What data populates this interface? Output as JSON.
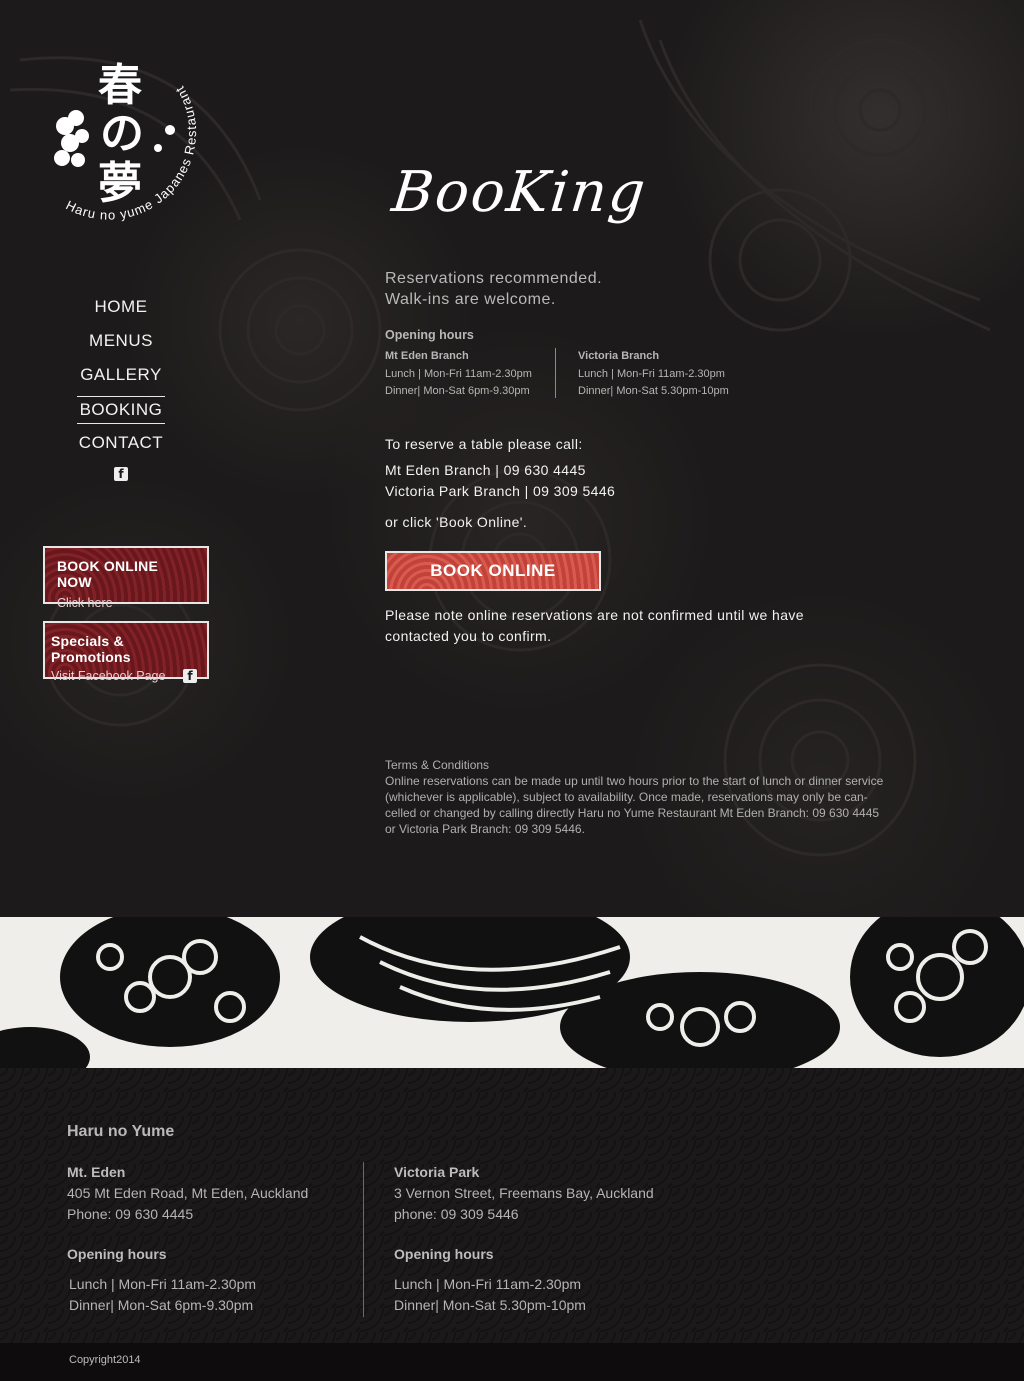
{
  "logo": {
    "kanji": [
      "春",
      "の",
      "夢"
    ],
    "ring_text": "Haru no yume Japanes Restaurant"
  },
  "nav": {
    "items": [
      "HOME",
      "MENUS",
      "GALLERY",
      "BOOKING",
      "CONTACT"
    ],
    "active": "BOOKING",
    "facebook_icon": "facebook-icon"
  },
  "promos": {
    "book_title": "BOOK ONLINE NOW",
    "book_sub": "Click here",
    "specials_title": "Specials & Promotions",
    "specials_sub": "Visit Facebook Page"
  },
  "main": {
    "title": "BooKing",
    "intro_line1": "Reservations recommended.",
    "intro_line2": "Walk-ins are welcome.",
    "hours_title": "Opening hours",
    "branches": [
      {
        "name": "Mt Eden Branch",
        "lunch": "Lunch | Mon-Fri   11am-2.30pm",
        "dinner": "Dinner| Mon-Sat  6pm-9.30pm"
      },
      {
        "name": "Victoria Branch",
        "lunch": "Lunch | Mon-Fri   11am-2.30pm",
        "dinner": "Dinner| Mon-Sat  5.30pm-10pm"
      }
    ],
    "reserve_intro": "To reserve a table please call:",
    "reserve_line1": "Mt Eden Branch | 09 630 4445",
    "reserve_line2": "Victoria Park Branch | 09 309 5446",
    "or_click": "or click 'Book Online'.",
    "book_button": "BOOK ONLINE",
    "note": "Please note online reservations are not confirmed until we have contacted you to confirm.",
    "terms_title": "Terms & Conditions",
    "terms_body": "Online reservations can be made up until two hours prior to the start of lunch or dinner service (whichever is applicable), subject to availability. Once made, reservations may only be can-celled or changed by calling directly Haru no Yume Restaurant Mt Eden Branch: 09 630 4445 or  Victoria Park Branch: 09 309 5446."
  },
  "footer": {
    "brand": "Haru no Yume",
    "left": {
      "name": "Mt. Eden",
      "address": "405 Mt Eden Road, Mt Eden, Auckland",
      "phone": "Phone: 09 630 4445",
      "hours_title": "Opening hours",
      "lunch": "Lunch | Mon-Fri   11am-2.30pm",
      "dinner": "Dinner| Mon-Sat  6pm-9.30pm"
    },
    "right": {
      "name": "Victoria Park",
      "address": "3 Vernon Street, Freemans Bay, Auckland",
      "phone": "phone: 09 309 5446",
      "hours_title": "Opening hours",
      "lunch": "Lunch | Mon-Fri   11am-2.30pm",
      "dinner": "Dinner| Mon-Sat  5.30pm-10pm"
    },
    "copyright": "Copyright2014"
  }
}
